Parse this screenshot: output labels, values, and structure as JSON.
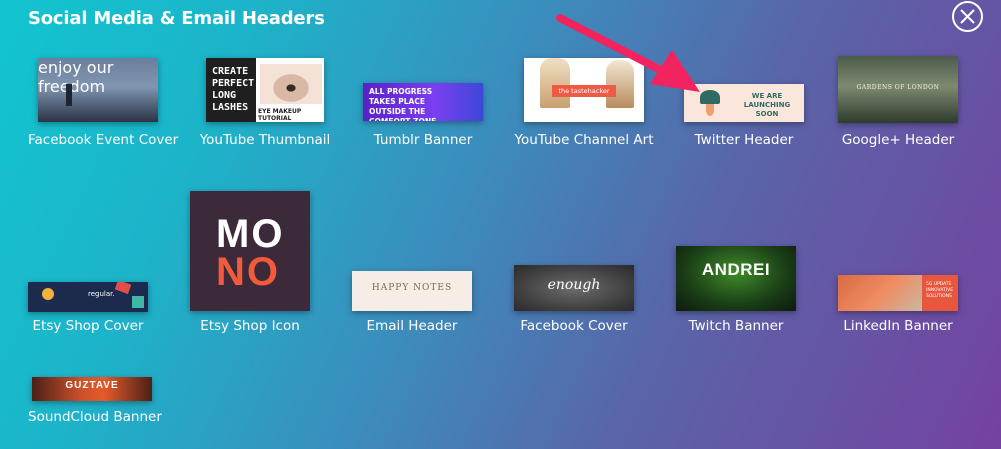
{
  "header": {
    "title": "Social Media & Email Headers"
  },
  "close": {
    "icon": "close-icon"
  },
  "templates": [
    {
      "label": "Facebook Event Cover",
      "thumb_text": "enjoy our freedom"
    },
    {
      "label": "YouTube Thumbnail",
      "thumb_text": "CREATE PERFECT LONG LASHES",
      "thumb_caption": "EYE MAKEUP TUTORIAL"
    },
    {
      "label": "Tumblr Banner",
      "thumb_text": "ALL PROGRESS TAKES PLACE OUTSIDE THE COMFORT ZONE"
    },
    {
      "label": "YouTube Channel Art",
      "thumb_text": "the tastehacker"
    },
    {
      "label": "Twitter Header",
      "thumb_text": "WE ARE LAUNCHING SOON"
    },
    {
      "label": "Google+ Header",
      "thumb_text": "GARDENS OF LONDON"
    },
    {
      "label": "Etsy Shop Cover",
      "thumb_text": "regular."
    },
    {
      "label": "Etsy Shop Icon",
      "thumb_text_top": "MO",
      "thumb_text_bottom": "NO"
    },
    {
      "label": "Email Header",
      "thumb_text": "HAPPY NOTES"
    },
    {
      "label": "Facebook Cover",
      "thumb_text": "enough"
    },
    {
      "label": "Twitch Banner",
      "thumb_text": "ANDREI"
    },
    {
      "label": "LinkedIn Banner",
      "thumb_text": "5G UPDATE INNOVATIVE SOLUTIONS"
    },
    {
      "label": "SoundCloud Banner",
      "thumb_text": "GUZTAVE"
    }
  ],
  "annotation": {
    "arrow_color": "#f2245f",
    "target": "Twitter Header"
  }
}
